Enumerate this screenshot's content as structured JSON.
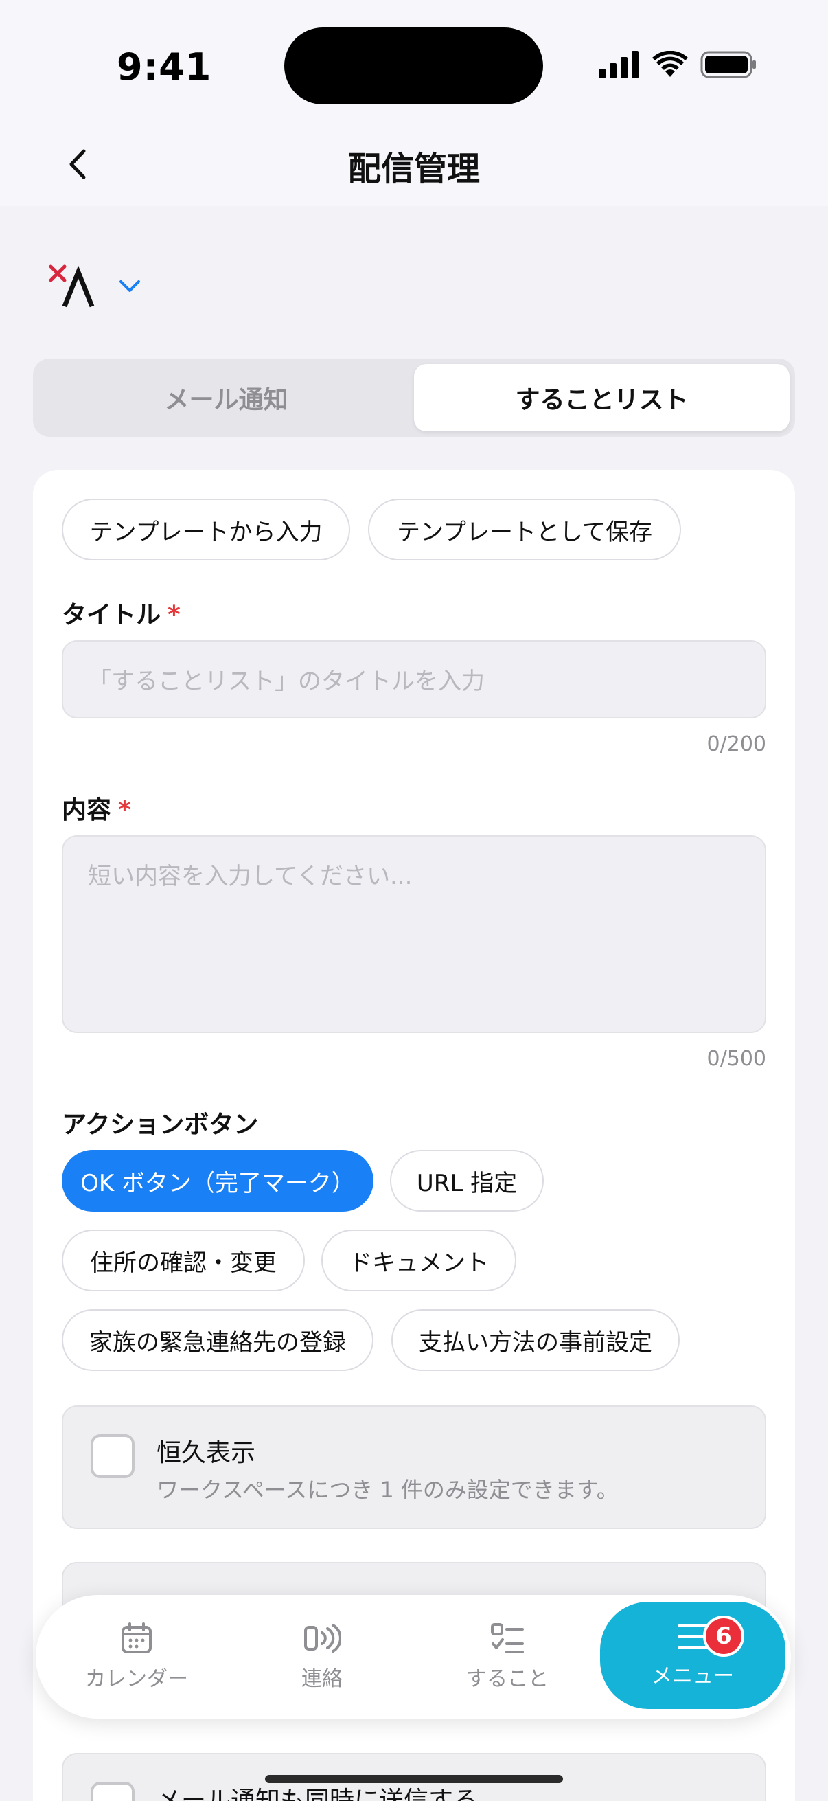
{
  "status_bar": {
    "time": "9:41"
  },
  "header": {
    "title": "配信管理"
  },
  "logo": {
    "text": "Λ"
  },
  "segment": {
    "tab1": "メール通知",
    "tab2": "することリスト",
    "active": 2
  },
  "templates": {
    "load_button": "テンプレートから入力",
    "save_button": "テンプレートとして保存"
  },
  "title_field": {
    "label": "タイトル",
    "required_mark": "*",
    "placeholder": "「することリスト」のタイトルを入力",
    "counter": "0/200"
  },
  "content_field": {
    "label": "内容",
    "required_mark": "*",
    "placeholder": "短い内容を入力してください...",
    "counter": "0/500"
  },
  "actions": {
    "label": "アクションボタン",
    "options": [
      {
        "label": "OK ボタン（完了マーク）",
        "selected": true
      },
      {
        "label": "URL 指定",
        "selected": false
      },
      {
        "label": "住所の確認・変更",
        "selected": false
      },
      {
        "label": "ドキュメント",
        "selected": false
      },
      {
        "label": "家族の緊急連絡先の登録",
        "selected": false
      },
      {
        "label": "支払い方法の事前設定",
        "selected": false
      }
    ]
  },
  "permanent": {
    "title": "恒久表示",
    "description": "ワークスペースにつき 1 件のみ設定できます。",
    "checked": false
  },
  "email_also": {
    "title": "メール通知も同時に送信する",
    "checked": false
  },
  "tabbar": {
    "items": [
      {
        "label": "カレンダー",
        "icon": "calendar-icon"
      },
      {
        "label": "連絡",
        "icon": "broadcast-icon"
      },
      {
        "label": "すること",
        "icon": "checklist-icon"
      },
      {
        "label": "メニュー",
        "icon": "menu-icon"
      }
    ],
    "badge": "6",
    "active": 4
  },
  "colors": {
    "accent": "#1a80f5",
    "tab_active": "#16b3d8",
    "badge": "#ea2f3a",
    "required": "#e5383b",
    "logo_x": "#d7263d"
  }
}
